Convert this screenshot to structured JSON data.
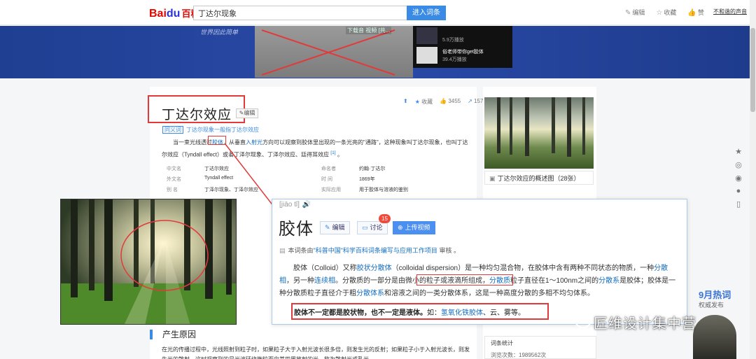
{
  "header": {
    "logo_text": "Bai",
    "logo_du": "du",
    "logo_product": "百科",
    "search_value": "丁达尔现象",
    "search_button": "进入词条",
    "actions": [
      {
        "icon": "pencil-icon",
        "label": "编辑"
      },
      {
        "icon": "star-icon",
        "label": "收藏"
      },
      {
        "icon": "thumbs-up-icon",
        "label": "赞"
      }
    ],
    "top_link": "不和谐的声音"
  },
  "banner": {
    "slogan": "世界因此简单",
    "video_label": "下载音 视频 [共...",
    "list": [
      {
        "title": "",
        "count": "5.9万播放"
      },
      {
        "title": "俗老师带你get胶体",
        "count": "39.4万播放"
      }
    ]
  },
  "article": {
    "title": "丁达尔效应",
    "edit_label": "编辑",
    "meta": {
      "favorite": "收藏",
      "likes": "3455",
      "shares": "157"
    },
    "polysemy_tag": "同义词",
    "polysemy_text": "丁达尔现象一般指丁达尔效应",
    "intro_pre": "当一束光线透过",
    "intro_link1": "胶体",
    "intro_mid": "，从垂直",
    "intro_link2": "入射光",
    "intro_post": "方向可以观察到胶体里出现的一条光亮的\"通路\"，这种现象叫丁达尔现象，也叫丁达尔效应（Tyndall effect）或者丁泽尔现象、丁泽尔效应、廷得耳效应",
    "intro_ref": "[1]",
    "info_rows": [
      {
        "k": "中文名",
        "v": "丁达尔效应",
        "k2": "命名者",
        "v2": "约翰·丁达尔"
      },
      {
        "k": "外文名",
        "v": "Tyndall effect",
        "k2": "时    间",
        "v2": "1869年"
      },
      {
        "k": "别    名",
        "v": "丁泽尔现象、丁泽尔效应",
        "k2": "实际应用",
        "v2": "用于胶体与溶液的鉴别"
      }
    ],
    "side_caption": "丁达尔效应的概述图（28张）",
    "section_title": "产生原因",
    "section_text": "在光的传播过程中，光线照射到粒子时，如果粒子大于入射光波长很多倍，则发生光的反射；如果粒子小于入射光波长，则发生光的散射，这时观察到的是光波环绕微粒而向其四周放射的光，称为散射光或乳光。"
  },
  "popup": {
    "pinyin": "[jiāo tǐ]",
    "title": "胶体",
    "edit_label": "编辑",
    "discuss_label": "讨论",
    "discuss_count": "15",
    "upload_label": "上传视频",
    "source_pre": "本词条由",
    "source_link": "\"科普中国\"科学百科词条编写与应用工作项目",
    "source_post": " 审核 。",
    "body_1": "胶体（Colloid）又称",
    "body_link1": "胶状分散体",
    "body_2": "（colloidal dispersion）是一种均匀混合物，在胶体中含有两种不同状态的物质，一种",
    "body_link2": "分散相",
    "body_3": "，另一种",
    "body_link3": "连续相",
    "body_4": "。分散质的一部分是由微小的粒子或液滴所组成，",
    "body_link4": "分散质",
    "body_5": "粒子直径在1～100nm之间的",
    "body_link5": "分散系",
    "body_6": "是胶体；胶体是一种分散质粒子直径介于粗",
    "body_link6": "分散体系",
    "body_7": "和溶液之间的一类分散体系，这是一种高度分散的多相不均匀体系。",
    "key_bold": "胶体不一定都是胶状物，也不一定是液体。",
    "key_pre": "如：",
    "key_link": "氢氧化铁胶体",
    "key_post": "、云、雾等。"
  },
  "float_icons": [
    "star-icon",
    "weibo-icon",
    "qq-icon",
    "wechat-icon",
    "mobile-icon"
  ],
  "hot": {
    "title": "9月热词",
    "sub": "权威发布"
  },
  "watermark": "匠维设计集中营",
  "stats": {
    "title": "词条统计",
    "views": "浏览次数：1989562次"
  }
}
